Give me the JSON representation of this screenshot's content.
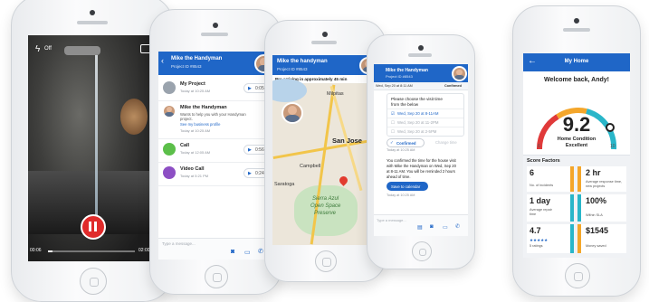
{
  "video": {
    "flash_label": "Off",
    "time_elapsed": "00:06",
    "time_total": "02:00"
  },
  "chats": {
    "title": "Mike the Handyman",
    "project_id": "Project ID #8543",
    "items": [
      {
        "name": "My Project",
        "time": "Today at 10:25 AM",
        "action": "0:05"
      },
      {
        "name": "Mike the Handyman",
        "line1": "Wants to help you with your Handyman",
        "line2": "project.",
        "link": "See my business profile",
        "time": "Today at 10:25 AM"
      },
      {
        "name": "Call",
        "time": "Today at 12:05 AM",
        "action": "0:56"
      },
      {
        "name": "Video Call",
        "time": "Today at 5:21 PM",
        "action": "0:24"
      }
    ],
    "input_placeholder": "Type a message..."
  },
  "map": {
    "title": "Mike the handyman",
    "project_id": "Project ID #8543",
    "banner": "Pro arriving in approximately 45 min",
    "places": [
      "Milpitas",
      "San Jose",
      "Campbell",
      "Saratoga",
      "Sierra Azul",
      "Open Space",
      "Preserve"
    ]
  },
  "schedule": {
    "title": "Mike the Handyman",
    "project_id": "Project ID #8543",
    "date_bar": "Wed, Sep 20 at 8:11 AM",
    "status": "Confirmed",
    "prompt_line1": "Please choose the visit time",
    "prompt_line2": "from the below",
    "options": [
      "Wed, Sep 20 at 8-11AM",
      "Wed, Sep 20 at 11-2PM",
      "Wed, Sep 20 at 2-5PM"
    ],
    "confirmed_label": "Confirmed",
    "change_label": "Change time",
    "time1": "Today at 10:25 AM",
    "message_lines": [
      "You confirmed the time for the house visit",
      "with Mike the Handyman on Wed, Sep 20",
      "at 8-11 AM. You will be reminded 2 hours",
      "ahead of time."
    ],
    "calendar_button": "Save to calendar",
    "time2": "Today at 10:25 AM",
    "input_placeholder": "Type a message..."
  },
  "home": {
    "title": "My Home",
    "welcome": "Welcome back, Andy!",
    "score": "9.2",
    "score_label_1": "Home Condition",
    "score_label_2": "Excellent",
    "gauge_min": "6",
    "gauge_max": "10",
    "factors_title": "Score Factors",
    "factors": [
      {
        "value": "6",
        "label": "No. of incidents",
        "accent": "#f4a62a"
      },
      {
        "value": "2 hr",
        "label": "Average response time, new projects",
        "accent": "#f4a62a"
      },
      {
        "value": "1 day",
        "label": "Average repair time",
        "accent": "#29b6c9"
      },
      {
        "value": "100%",
        "label": "Within SLA",
        "accent": "#29b6c9"
      },
      {
        "value": "4.7",
        "label": "5 ratings",
        "stars": "★★★★★",
        "accent": "#29b6c9"
      },
      {
        "value": "$1545",
        "label": "Money saved",
        "accent": "#f4a62a"
      }
    ]
  }
}
